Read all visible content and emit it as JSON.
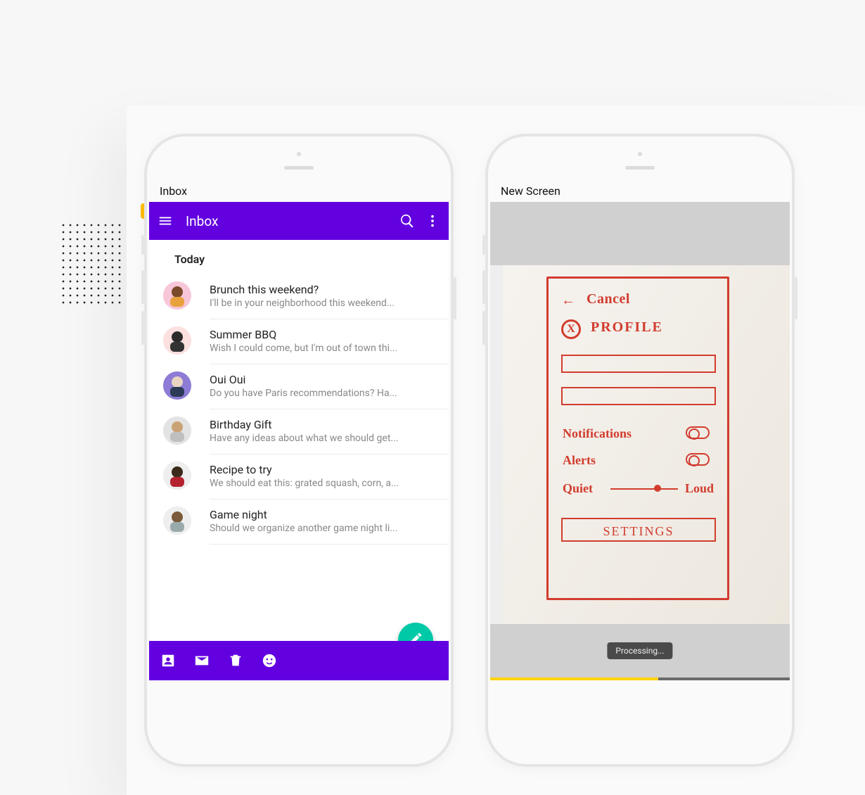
{
  "colors": {
    "accent": "#6200e0",
    "fab": "#00c9a7",
    "home_tab": "#ffbf00",
    "sketch_ink": "#d23c2e"
  },
  "phone_left": {
    "label": "Inbox",
    "app_bar": {
      "title": "Inbox"
    },
    "section_header": "Today",
    "messages": [
      {
        "title": "Brunch this weekend?",
        "snippet": "I'll be in your neighborhood this weekend..."
      },
      {
        "title": "Summer BBQ",
        "snippet": "Wish I could come, but I'm out of town thi..."
      },
      {
        "title": "Oui Oui",
        "snippet": "Do you have Paris recommendations? Ha..."
      },
      {
        "title": "Birthday Gift",
        "snippet": "Have any ideas about what we should get..."
      },
      {
        "title": "Recipe to try",
        "snippet": "We should eat this: grated squash, corn, a..."
      },
      {
        "title": "Game night",
        "snippet": "Should we organize another game night li..."
      }
    ]
  },
  "phone_right": {
    "label": "New Screen",
    "sketch": {
      "cancel": "Cancel",
      "profile": "PROFILE",
      "notifications": "Notifications",
      "alerts": "Alerts",
      "quiet": "Quiet",
      "loud": "Loud",
      "settings": "SETTINGS"
    },
    "status_text": "Processing...",
    "progress_percent": 56
  }
}
